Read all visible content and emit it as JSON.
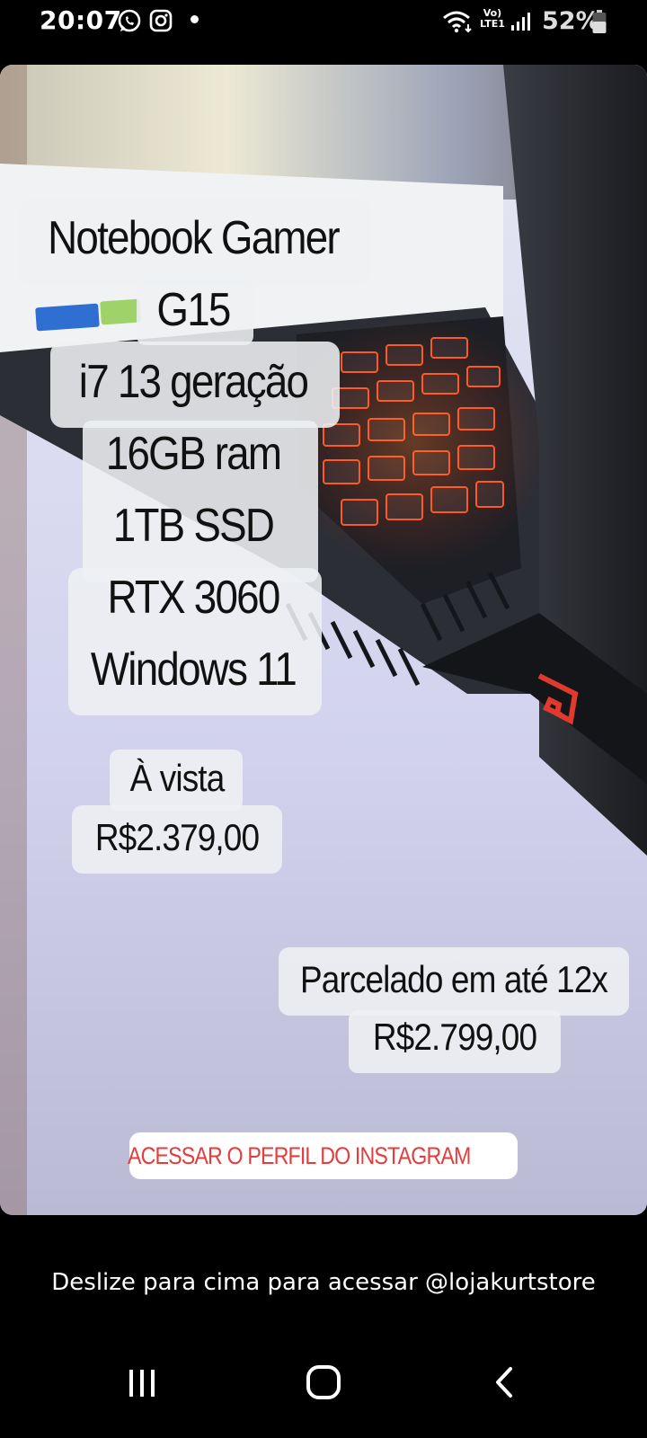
{
  "status_bar": {
    "time": "20:07",
    "notification_icons": [
      "whatsapp-icon",
      "instagram-icon"
    ],
    "network_label_top": "Vo)",
    "network_label_bottom": "LTE1",
    "battery_percent": "52%"
  },
  "story": {
    "spec_lines": [
      "Notebook Gamer",
      "G15",
      "i7 13 geração",
      "16GB ram",
      "1TB SSD",
      "RTX 3060",
      "Windows 11"
    ],
    "cash_label": "À vista",
    "cash_price": "R$2.379,00",
    "installment_label": "Parcelado em até 12x",
    "installment_price": "R$2.799,00",
    "link_sticker": {
      "icon": "link-icon",
      "label": "ACESSAR O PERFIL DO INSTAGRAM",
      "color": "#e33d3d"
    }
  },
  "footer": {
    "swipe_hint": "Deslize para cima para acessar @lojakurtstore"
  },
  "nav_bar": {
    "buttons": [
      "recent-apps-icon",
      "home-icon",
      "back-icon"
    ]
  }
}
